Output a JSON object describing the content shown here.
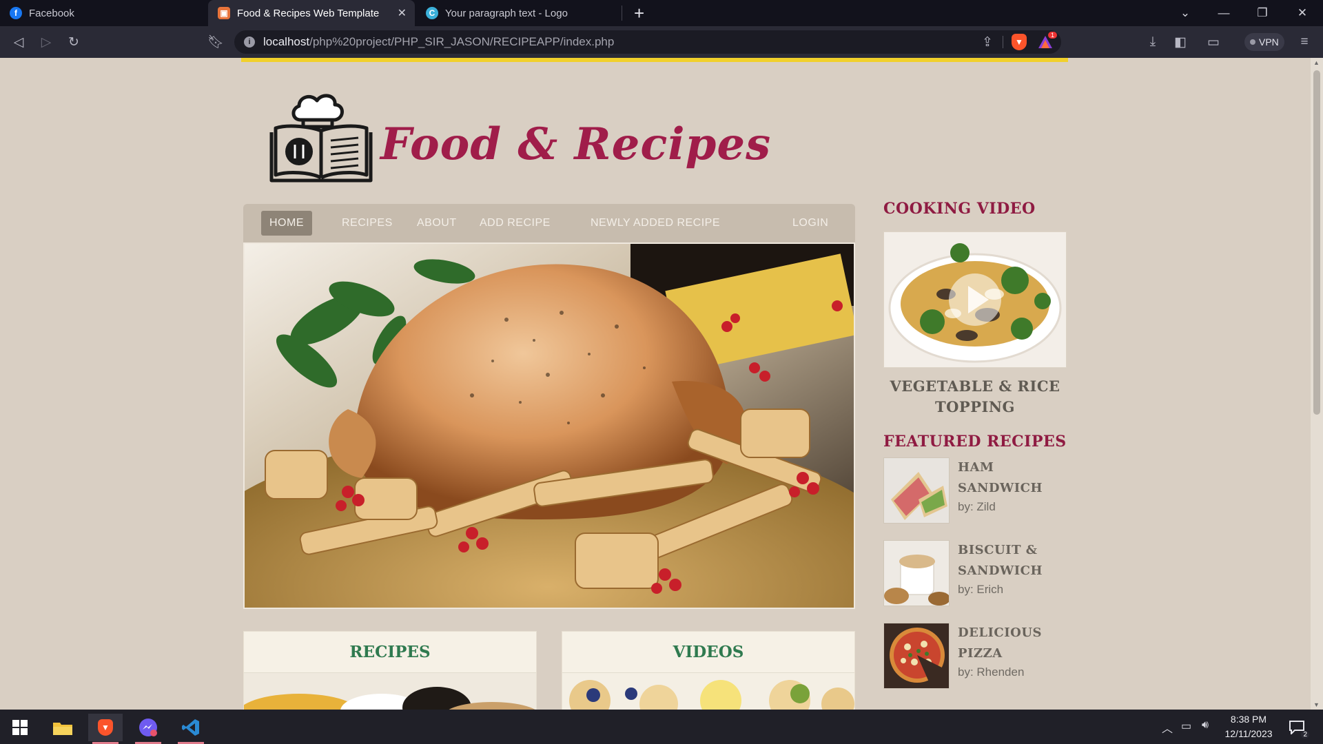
{
  "browser": {
    "tabs": [
      {
        "label": "Facebook",
        "icon": "facebook-icon",
        "active": false
      },
      {
        "label": "Food & Recipes Web Template",
        "icon": "template-icon",
        "active": true
      },
      {
        "label": "Your paragraph text - Logo",
        "icon": "canva-icon",
        "active": false
      }
    ],
    "url_host": "localhost",
    "url_path": "/php%20project/PHP_SIR_JASON/RECIPEAPP/index.php",
    "vpn_label": "VPN",
    "brave_badge": "1",
    "accent": "#fb542b"
  },
  "site": {
    "brand": "Food & Recipes",
    "nav": [
      "HOME",
      "RECIPES",
      "ABOUT",
      "ADD RECIPE",
      "NEWLY ADDED RECIPE",
      "LOGIN"
    ],
    "active_nav": "HOME",
    "cards": [
      {
        "title": "RECIPES"
      },
      {
        "title": "VIDEOS"
      }
    ],
    "sidebar": {
      "cooking_video_heading": "COOKING VIDEO",
      "video_title": "VEGETABLE & RICE TOPPING",
      "featured_heading": "FEATURED RECIPES",
      "featured": [
        {
          "name": "HAM SANDWICH",
          "by": "by: Zild"
        },
        {
          "name": "BISCUIT & SANDWICH",
          "by": "by: Erich"
        },
        {
          "name": "DELICIOUS PIZZA",
          "by": "by: Rhenden"
        }
      ]
    },
    "colors": {
      "background": "#d9cfc3",
      "brand": "#a01d4a",
      "heading": "#8f1b42",
      "card_title": "#2f7a4f",
      "menu": "#c7bcae",
      "menu_active": "#8e8477",
      "top_strip": "#f1d02b"
    }
  },
  "taskbar": {
    "time": "8:38 PM",
    "date": "12/11/2023",
    "notification_count": "2",
    "apps": [
      "windows-start-icon",
      "file-explorer-icon",
      "brave-browser-icon",
      "messenger-icon",
      "vscode-icon"
    ]
  }
}
